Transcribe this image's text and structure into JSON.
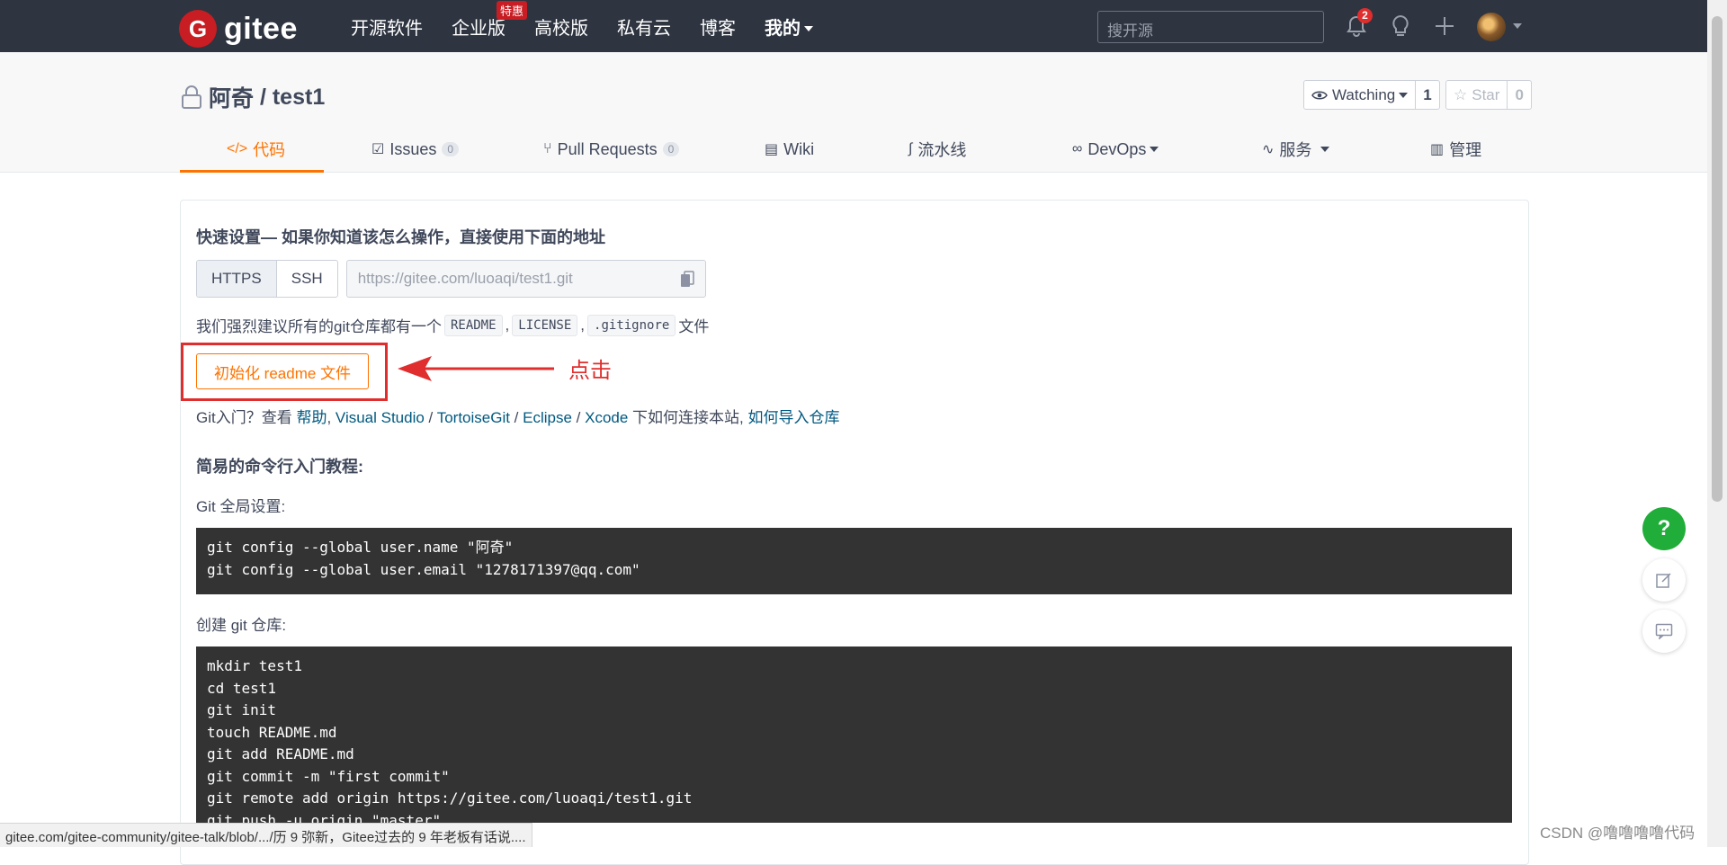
{
  "topbar": {
    "logo_mark": "G",
    "logo_text": "gitee",
    "nav": [
      {
        "label": "开源软件"
      },
      {
        "label": "企业版",
        "badge": "特惠"
      },
      {
        "label": "高校版"
      },
      {
        "label": "私有云"
      },
      {
        "label": "博客"
      },
      {
        "label": "我的"
      }
    ],
    "search_placeholder": "搜开源",
    "notification_count": "2"
  },
  "repo": {
    "owner": "阿奇",
    "separator": " / ",
    "name": "test1",
    "watch_label": "Watching",
    "watch_count": "1",
    "star_label": "Star",
    "star_count": "0"
  },
  "tabs": [
    {
      "label": "代码",
      "icon": "code-icon",
      "active": true
    },
    {
      "label": "Issues",
      "count": "0",
      "icon": "issues-icon"
    },
    {
      "label": "Pull Requests",
      "count": "0",
      "icon": "pull-request-icon"
    },
    {
      "label": "Wiki",
      "icon": "wiki-icon"
    },
    {
      "label": "流水线",
      "icon": "pipeline-icon"
    },
    {
      "label": "DevOps",
      "icon": "devops-icon"
    },
    {
      "label": "服务",
      "icon": "service-icon"
    },
    {
      "label": "管理",
      "icon": "manage-icon"
    }
  ],
  "quick": {
    "title": "快速设置— 如果你知道该怎么操作，直接使用下面的地址",
    "protocols": [
      "HTTPS",
      "SSH"
    ],
    "url": "https://gitee.com/luoaqi/test1.git",
    "suggest_prefix": "我们强烈建议所有的git仓库都有一个",
    "files": [
      "README",
      "LICENSE",
      ".gitignore"
    ],
    "comma": ",",
    "suggest_suffix": "文件",
    "init_button": "初始化 readme 文件",
    "annotation": "点击"
  },
  "help": {
    "prefix": "Git入门？查看 ",
    "links": [
      "帮助",
      "Visual Studio",
      "TortoiseGit",
      "Eclipse",
      "Xcode"
    ],
    "sep_comma": ", ",
    "sep_slash": " / ",
    "middle": " 下如何连接本站, ",
    "import_link": "如何导入仓库"
  },
  "tutorial": {
    "title": "简易的命令行入门教程:",
    "global_label": "Git 全局设置:",
    "global_code": [
      "git config --global user.name \"阿奇\"",
      "git config --global user.email \"1278171397@qq.com\""
    ],
    "create_label": "创建 git 仓库:",
    "create_code": [
      "mkdir test1",
      "cd test1",
      "git init",
      "touch README.md",
      "git add README.md",
      "git commit -m \"first commit\"",
      "git remote add origin https://gitee.com/luoaqi/test1.git",
      "git push -u origin \"master\""
    ]
  },
  "float": {
    "help_label": "?"
  },
  "status_url": "gitee.com/gitee-community/gitee-talk/blob/.../历 9 弥新，Gitee过去的 9 年老板有话说....",
  "watermark": "CSDN @噜噜噜噜代码"
}
